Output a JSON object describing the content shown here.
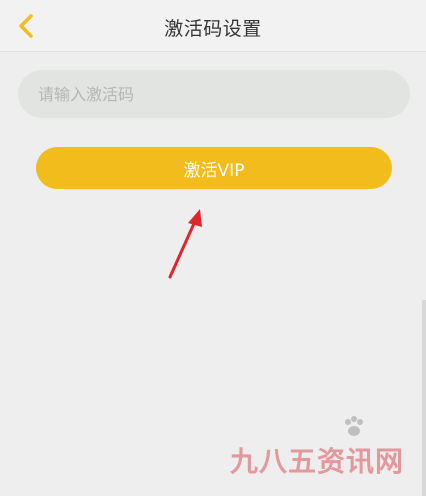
{
  "header": {
    "title": "激活码设置",
    "back_icon": "chevron-left-icon",
    "accent_color": "#F2BC1C"
  },
  "form": {
    "input_placeholder": "请输入激活码",
    "input_value": "",
    "activate_label": "激活VIP",
    "button_color": "#F2BC1C"
  },
  "annotation": {
    "arrow_icon": "red-arrow-icon",
    "arrow_color": "#E0262C"
  },
  "watermark": {
    "text": "九八五资讯网"
  }
}
